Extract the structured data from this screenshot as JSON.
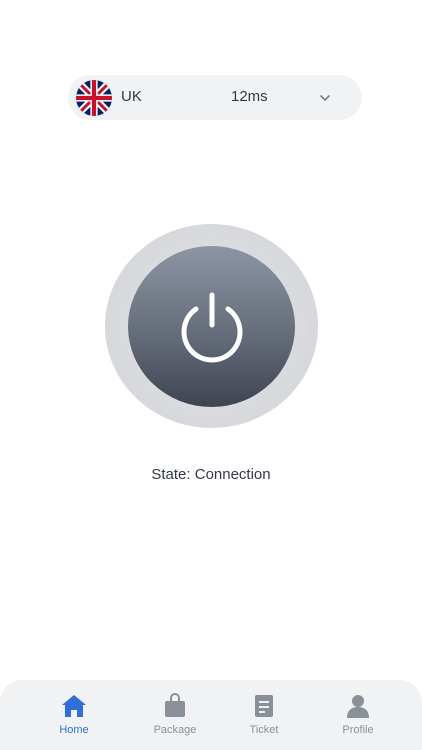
{
  "server": {
    "country": "UK",
    "latency": "12ms",
    "flag_icon": "uk-flag-icon",
    "dropdown_icon": "chevron-down-icon"
  },
  "power": {
    "icon": "power-icon",
    "state_text": "State: Connection"
  },
  "nav": {
    "items": [
      {
        "label": "Home",
        "icon": "home-icon",
        "active": true
      },
      {
        "label": "Package",
        "icon": "bag-icon",
        "active": false
      },
      {
        "label": "Ticket",
        "icon": "ticket-icon",
        "active": false
      },
      {
        "label": "Profile",
        "icon": "profile-icon",
        "active": false
      }
    ]
  },
  "colors": {
    "accent": "#2f6fd6",
    "inactive": "#8a9099",
    "text": "#333a45"
  }
}
